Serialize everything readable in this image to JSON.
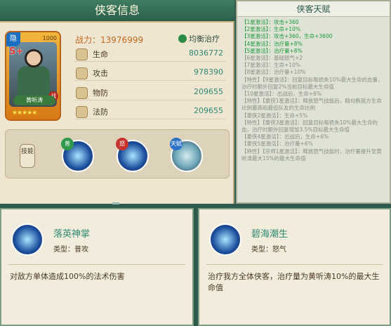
{
  "left_panel": {
    "title": "侠客信息",
    "card": {
      "tag": "隐",
      "rank": "S+",
      "level": "1000",
      "badge": "战",
      "name": "黄听涛",
      "stars": "★★★★★"
    },
    "power_label": "战力：",
    "power_value": "13976999",
    "role": "均衡治疗",
    "stats": [
      {
        "label": "生命",
        "value": "8036772"
      },
      {
        "label": "攻击",
        "value": "978390"
      },
      {
        "label": "物防",
        "value": "209655"
      },
      {
        "label": "法防",
        "value": "209655"
      }
    ],
    "skill_button": "技能",
    "skill_badges": [
      "普",
      "怒",
      "天赋"
    ]
  },
  "right_panel": {
    "title": "侠客天赋",
    "talents": [
      {
        "text": "【1星激活】：攻击+360",
        "active": true
      },
      {
        "text": "【2星激活】：生命+10%",
        "active": true
      },
      {
        "text": "【3星激活】：攻击+360，生命+3600",
        "active": true
      },
      {
        "text": "【4星激活】：治疗量+8%",
        "active": true
      },
      {
        "text": "【5星激活】：治疗量+8%",
        "active": true
      },
      {
        "text": "【6星激活】：基础怒气+2",
        "active": false
      },
      {
        "text": "【7星激活】：生命+10%",
        "active": false
      },
      {
        "text": "【8星激活】：治疗量+10%",
        "active": false
      },
      {
        "text": "【特性】【9星激活】：回复目标每损失10%最大生命的血量，治疗时额外回复2%当前目标最大生命值",
        "active": false
      },
      {
        "text": "【10星激活】：出战后，生命+6%",
        "active": false
      },
      {
        "text": "【特性】【豪侠1星激活】：释放怒气技能后，精均衡我方生命比例最高和最低队友的生命比例",
        "active": false
      },
      {
        "text": "【豪侠2星激活】：生命+5%",
        "active": false
      },
      {
        "text": "【特性】【豪侠3星激活】：回复目标每损失10%最大生命的血，治疗时额外回复增加3.5%目标最大生命值",
        "active": false
      },
      {
        "text": "【豪侠4星激活】：出战后，生命+6%",
        "active": false
      },
      {
        "text": "【豪侠5星激活】：治疗量+6%",
        "active": false
      },
      {
        "text": "【特性】【宗师1星激活】：释放怒气技能时，治疗量提升至黄听涛最大15%的最大生命值",
        "active": false
      }
    ]
  },
  "skills": [
    {
      "name": "落英神掌",
      "type": "类型：普攻",
      "desc": "对敌方单体造成100%的法术伤害"
    },
    {
      "name": "碧海潮生",
      "type": "类型：怒气",
      "desc": "治疗我方全体侠客，治疗量为黄听涛10%的最大生命值"
    }
  ]
}
